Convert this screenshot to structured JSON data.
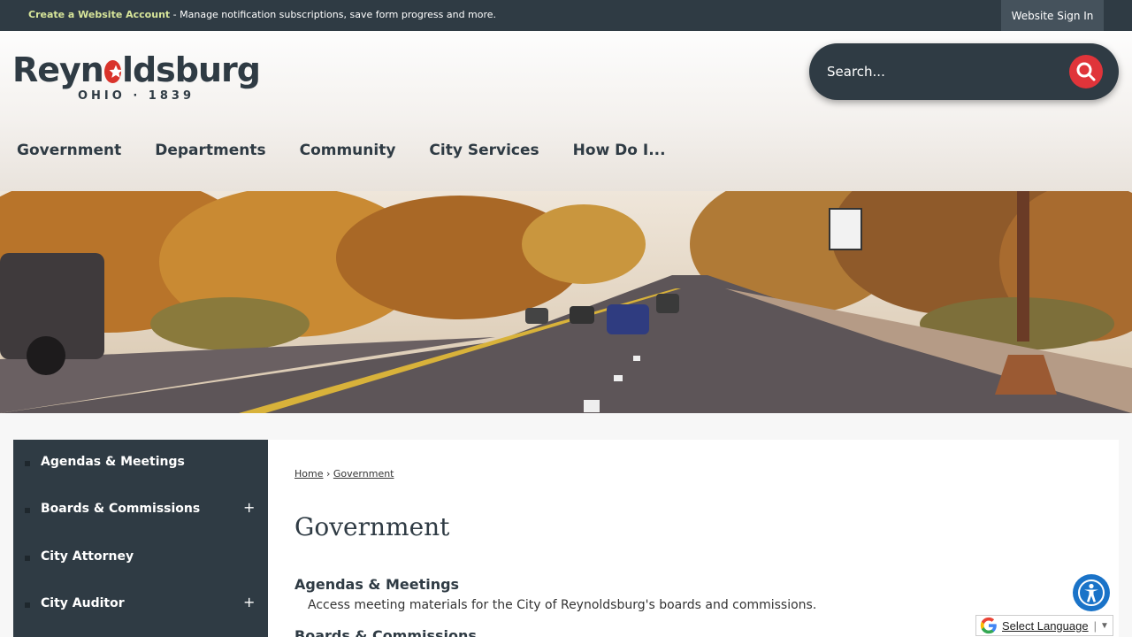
{
  "topbar": {
    "create_account_link": "Create a Website Account",
    "create_account_msg": " - Manage notification subscriptions, save form progress and more.",
    "signin_label": "Website Sign In"
  },
  "logo": {
    "word_left": "Reyn",
    "word_right": "ldsburg",
    "tagline": "OHIO · 1839"
  },
  "search": {
    "placeholder": "Search..."
  },
  "nav": [
    "Government",
    "Departments",
    "Community",
    "City Services",
    "How Do I..."
  ],
  "sidebar": {
    "items": [
      {
        "label": "Agendas & Meetings",
        "expand": ""
      },
      {
        "label": "Boards & Commissions",
        "expand": "+"
      },
      {
        "label": "City Attorney",
        "expand": ""
      },
      {
        "label": "City Auditor",
        "expand": "+"
      }
    ]
  },
  "breadcrumb": {
    "home": "Home",
    "sep": " › ",
    "current": "Government"
  },
  "page": {
    "title": "Government",
    "sections": [
      {
        "title": "Agendas & Meetings",
        "desc": "Access meeting materials for the City of Reynoldsburg's boards and commissions."
      },
      {
        "title": "Boards & Commissions",
        "desc": ""
      }
    ]
  },
  "translate": {
    "label": "Select Language",
    "sep": "|",
    "arrow": "▼"
  },
  "colors": {
    "dark": "#2f3b44",
    "accent_red": "#e0343a",
    "link_green": "#d8e69a",
    "a11y_blue": "#1a73c8"
  }
}
